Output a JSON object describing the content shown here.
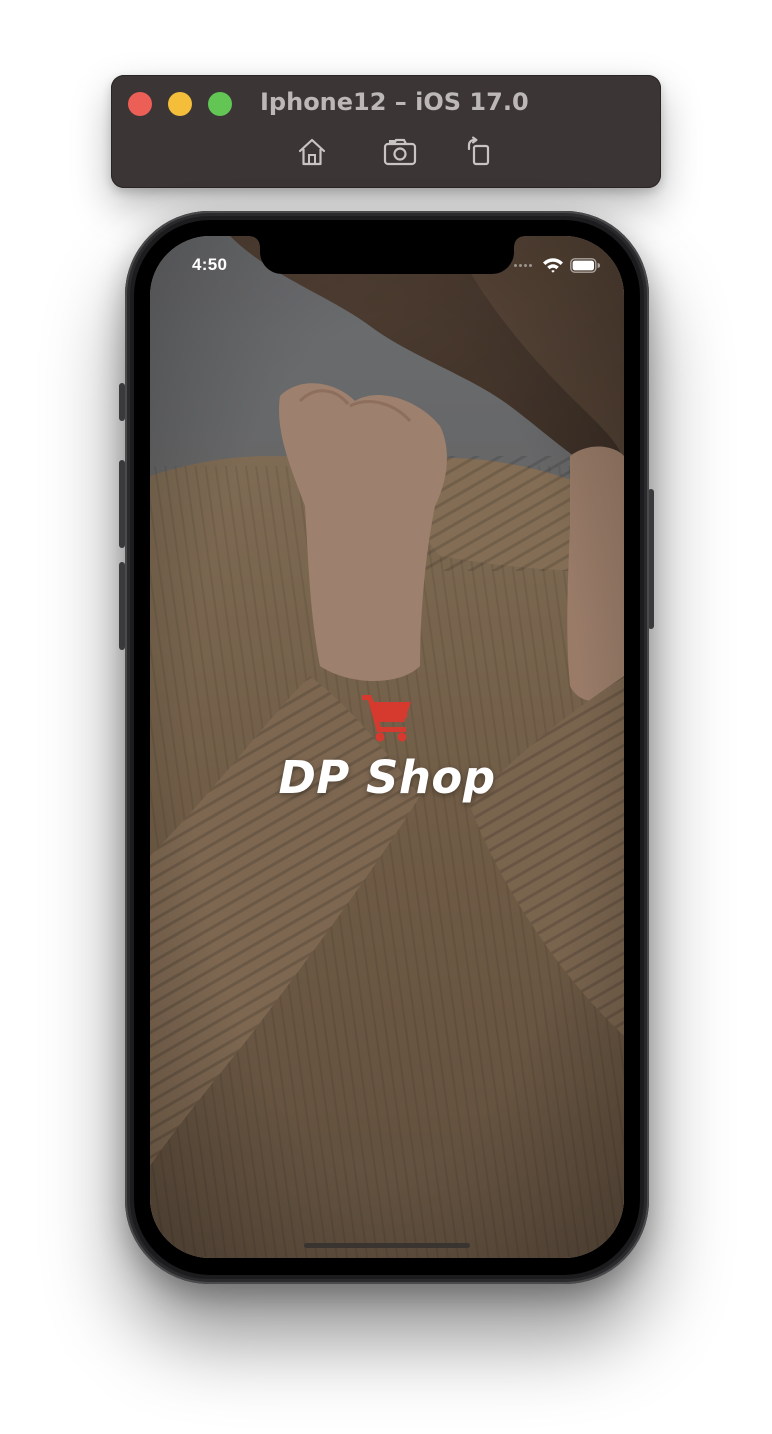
{
  "simulator": {
    "title": "Iphone12 – iOS 17.0",
    "buttons": [
      {
        "name": "home",
        "icon": "home-icon"
      },
      {
        "name": "screenshot",
        "icon": "camera-icon"
      },
      {
        "name": "rotate",
        "icon": "rotate-icon"
      }
    ],
    "colors": {
      "toolbar": "#3b3535",
      "close": "#ec5f56",
      "minimize": "#f4be3b",
      "maximize": "#62c554"
    }
  },
  "status_bar": {
    "time": "4:50",
    "icons": [
      "wifi-icon",
      "battery-icon"
    ]
  },
  "splash": {
    "icon": "shopping-cart-icon",
    "icon_color": "#d63a2f",
    "title": "DP Shop"
  }
}
